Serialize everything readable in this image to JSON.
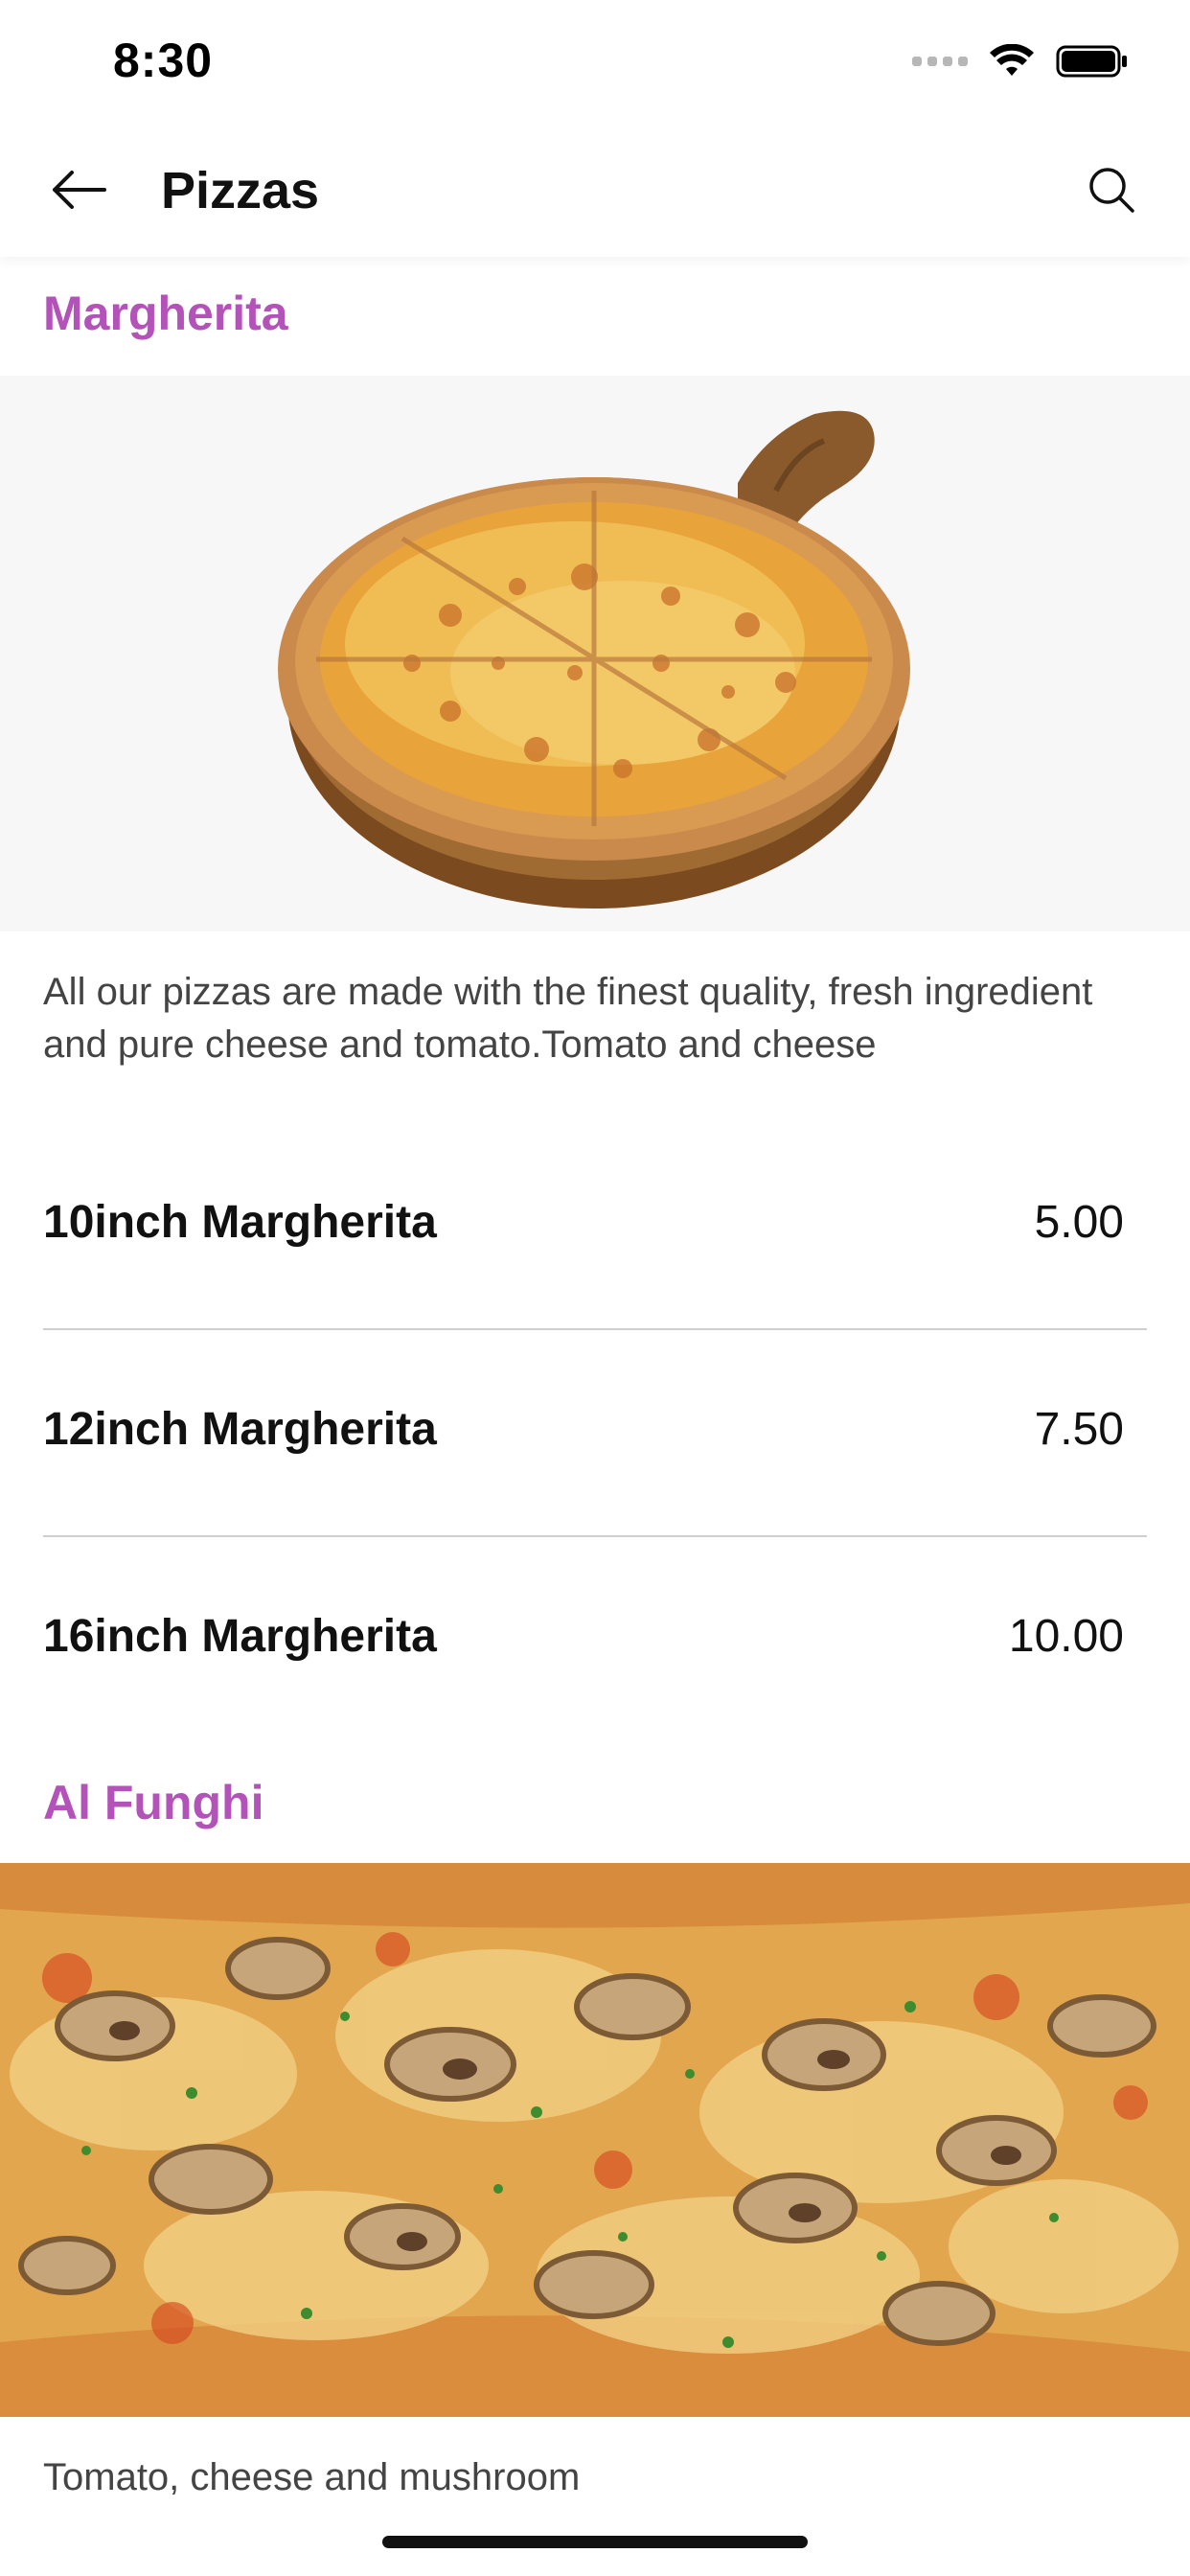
{
  "status_bar": {
    "time": "8:30"
  },
  "header": {
    "title": "Pizzas",
    "back_icon": "arrow-left-icon",
    "search_icon": "search-icon"
  },
  "sections": [
    {
      "title": "Margherita",
      "image": "margherita-pizza-image",
      "description": "All our pizzas are made with the finest quality, fresh ingredient and pure cheese and tomato.Tomato and cheese",
      "items": [
        {
          "name": "10inch Margherita",
          "price": "5.00"
        },
        {
          "name": "12inch Margherita",
          "price": "7.50"
        },
        {
          "name": "16inch Margherita",
          "price": "10.00"
        }
      ]
    },
    {
      "title": "Al Funghi",
      "image": "mushroom-pizza-image",
      "description": "Tomato, cheese and mushroom"
    }
  ],
  "colors": {
    "accent": "#b352b8",
    "text": "#111111",
    "muted_text": "#444444",
    "divider": "#cfcfcf"
  }
}
